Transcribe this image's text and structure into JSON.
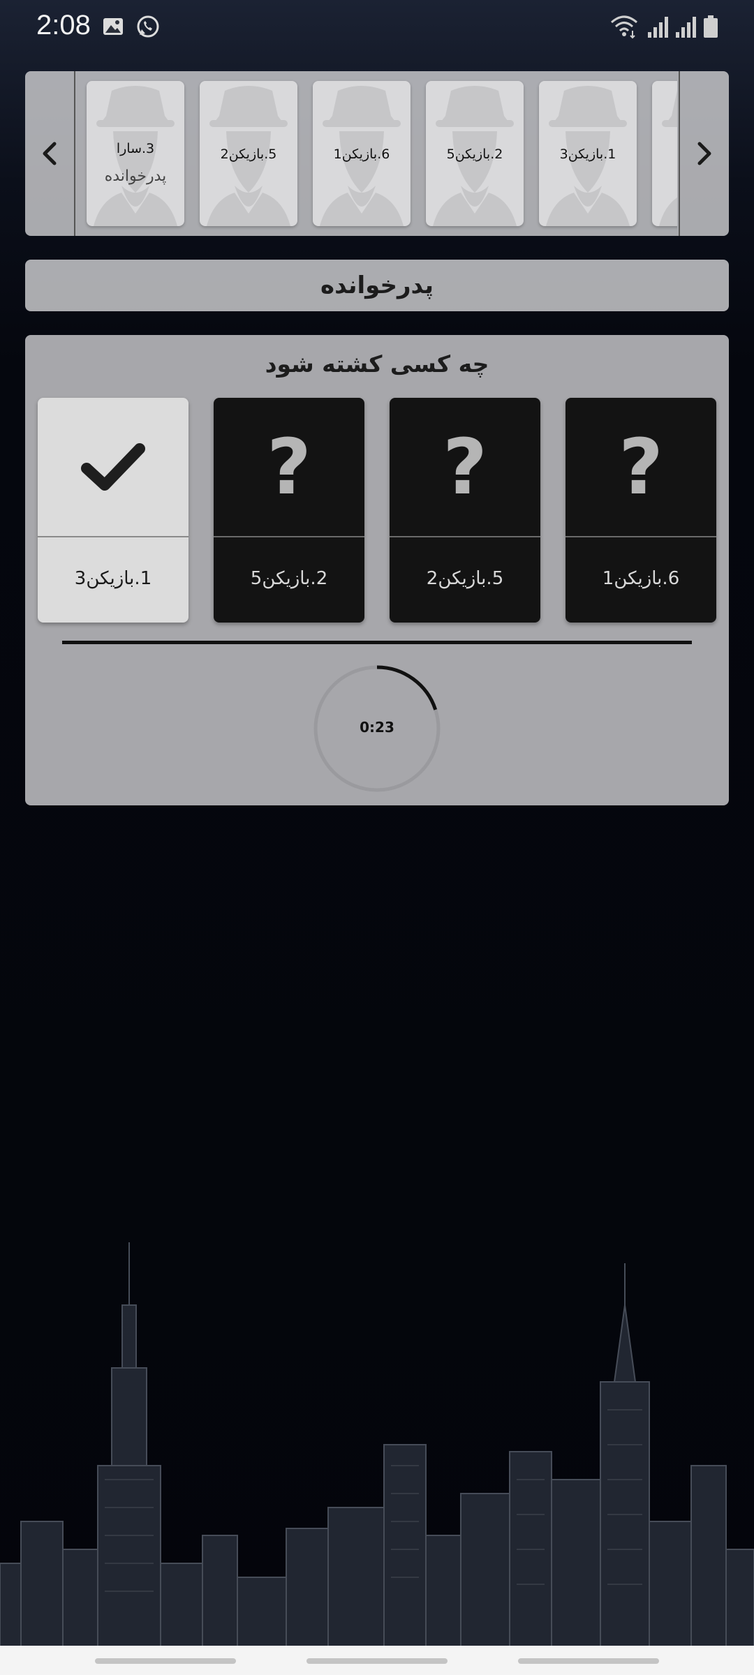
{
  "status_bar": {
    "time": "2:08",
    "icons": [
      "gallery-icon",
      "whatsapp-icon",
      "wifi-icon",
      "signal-icon",
      "signal-icon",
      "battery-icon"
    ]
  },
  "players_strip": {
    "prev_icon": "chevron-left-icon",
    "next_icon": "chevron-right-icon",
    "players": [
      {
        "name": "3.سارا",
        "role": "پدرخوانده"
      },
      {
        "name": "5.بازیکن2",
        "role": ""
      },
      {
        "name": "6.بازیکن1",
        "role": ""
      },
      {
        "name": "2.بازیکن5",
        "role": ""
      },
      {
        "name": "1.بازیکن3",
        "role": ""
      },
      {
        "name": "",
        "role": ""
      }
    ]
  },
  "role_bar": {
    "title": "پدرخوانده"
  },
  "kill_panel": {
    "question": "چه کسی کشته شود",
    "targets": [
      {
        "label": "6.بازیکن1",
        "state": "unknown",
        "icon": "question-mark-icon"
      },
      {
        "label": "5.بازیکن2",
        "state": "unknown",
        "icon": "question-mark-icon"
      },
      {
        "label": "2.بازیکن5",
        "state": "unknown",
        "icon": "question-mark-icon"
      },
      {
        "label": "1.بازیکن3",
        "state": "selected",
        "icon": "checkmark-icon"
      }
    ],
    "timer": {
      "text": "0:23",
      "progress": 0.2
    }
  },
  "colors": {
    "panel_bg": "#b0b0b4",
    "card_dark": "#131313",
    "card_selected": "#dcdcdc",
    "timer_arc": "#111111"
  }
}
